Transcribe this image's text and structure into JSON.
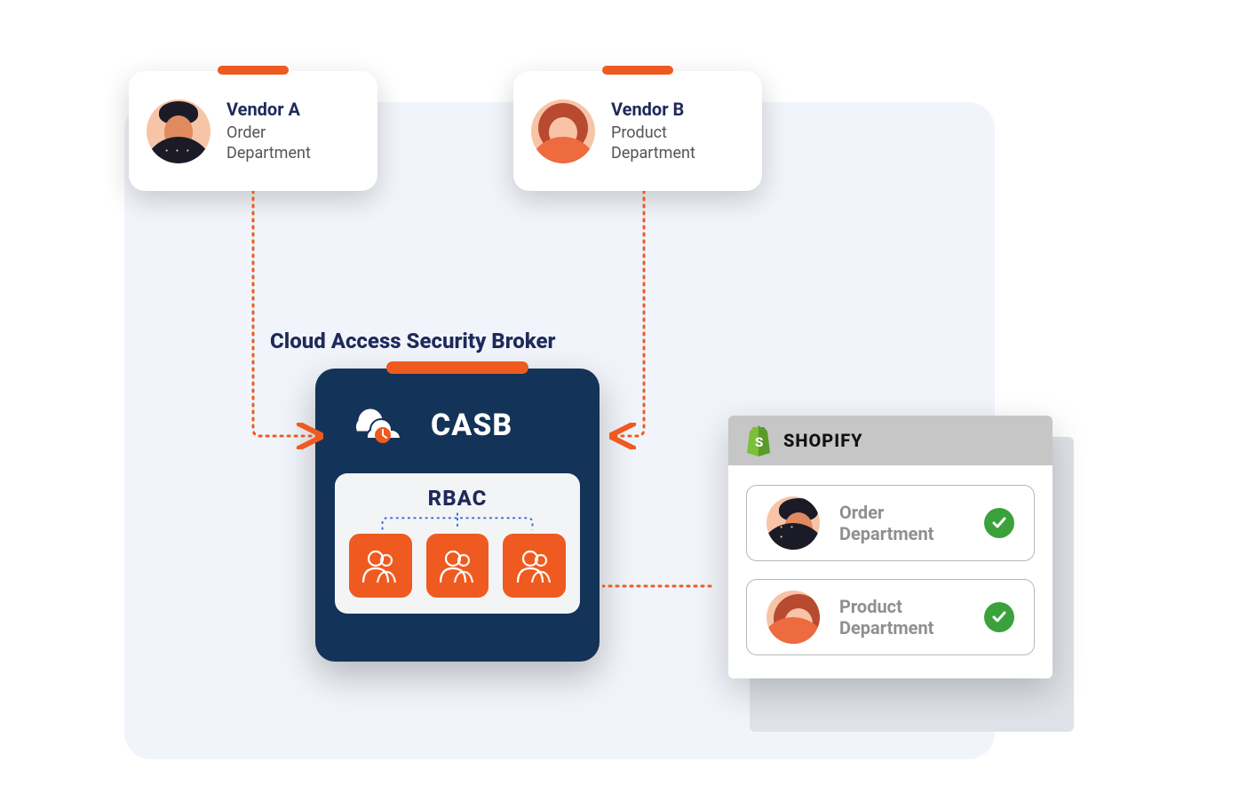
{
  "vendors": {
    "a": {
      "name": "Vendor A",
      "dept": "Order\nDepartment"
    },
    "b": {
      "name": "Vendor B",
      "dept": "Product\nDepartment"
    }
  },
  "casb": {
    "title": "Cloud Access Security Broker",
    "label": "CASB",
    "rbac_label": "RBAC"
  },
  "shopify": {
    "title": "SHOPIFY",
    "rows": {
      "order": "Order Department",
      "product": "Product Department"
    }
  },
  "colors": {
    "accent": "#ee5a1f",
    "navy": "#143358",
    "green": "#3ba23b"
  }
}
